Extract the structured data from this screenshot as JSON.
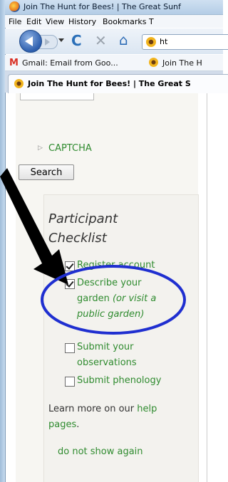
{
  "window": {
    "title": "Join The Hunt for Bees! | The Great Sunf",
    "menu": [
      "File",
      "Edit",
      "View",
      "History",
      "Bookmarks",
      "T"
    ]
  },
  "nav": {
    "url_partial": "ht"
  },
  "bookmarks": [
    {
      "label": "Gmail: Email from Goo...",
      "icon": "gmail-icon"
    },
    {
      "label": "Join The H",
      "icon": "sunflower-icon"
    }
  ],
  "tab": {
    "label": "Join The Hunt for Bees! | The Great S"
  },
  "sidebar": {
    "captcha_label": "CAPTCHA",
    "search_button": "Search"
  },
  "checklist": {
    "title_line1": "Participant",
    "title_line2": "Checklist",
    "items": [
      {
        "text": "Register account",
        "checked": true
      },
      {
        "line1": "Describe your",
        "line2": "garden",
        "note_part1": "(or visit a",
        "note_link": "public garden",
        "note_end": ")",
        "checked": true
      },
      {
        "line1": "Submit your",
        "line2": "observations",
        "checked": false
      },
      {
        "text": "Submit phenology",
        "checked": false
      }
    ],
    "learn_text": "Learn more on our",
    "learn_link1": "help",
    "learn_link2": "pages",
    "learn_period": ".",
    "dismiss_label": "do not show again"
  },
  "colors": {
    "link_green": "#2f8b2f",
    "annotation_blue": "#1f2fd0",
    "arrow_black": "#000000"
  }
}
